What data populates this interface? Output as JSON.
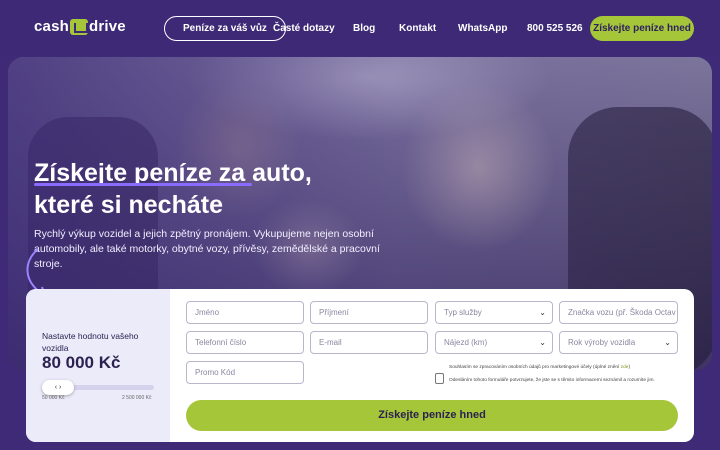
{
  "header": {
    "logo_left": "cash",
    "logo_right": "drive",
    "nav": {
      "pill": "Peníze za váš vůz",
      "faq": "Časté dotazy",
      "blog": "Blog",
      "contact": "Kontakt",
      "whatsapp": "WhatsApp",
      "phone": "800 525 526"
    },
    "cta": "Získejte peníze hned"
  },
  "hero": {
    "title_line1": "Získejte peníze za auto,",
    "title_line2": "které si necháte",
    "description": "Rychlý výkup vozidel a jejich zpětný pronájem. Vykupujeme nejen osobní automobily, ale také motorky, obytné vozy, přívěsy, zemědělské a pracovní stroje."
  },
  "form": {
    "slider": {
      "label": "Nastavte hodnotu vašeho vozidla",
      "value": "80 000 Kč",
      "handle": "‹  ›",
      "min": "50 000 Kč",
      "max": "2 500 000 Kč",
      "level_fraction": 0.0
    },
    "fields": {
      "first_name": "Jméno",
      "last_name": "Příjmení",
      "service_type": "Typ služby",
      "car_brand": "Značka vozu (př. Škoda Octav",
      "phone": "Telefonní číslo",
      "email": "E-mail",
      "mileage": "Nájezd (km)",
      "year": "Rok výroby vozidla",
      "promo": "Promo Kód"
    },
    "consent_marketing": "Souhlasím se zpracováním osobních údajů pro marketingové účely (úplné znění",
    "consent_link": "zde",
    "consent_info": "Odesláním tohoto formuláře potvrzujete, že jste se s těmito informacemi seznámil a rozumíte jim.",
    "submit": "Získejte peníze hned"
  },
  "colors": {
    "brand_purple": "#3d2975",
    "accent_green": "#a6c63a"
  }
}
